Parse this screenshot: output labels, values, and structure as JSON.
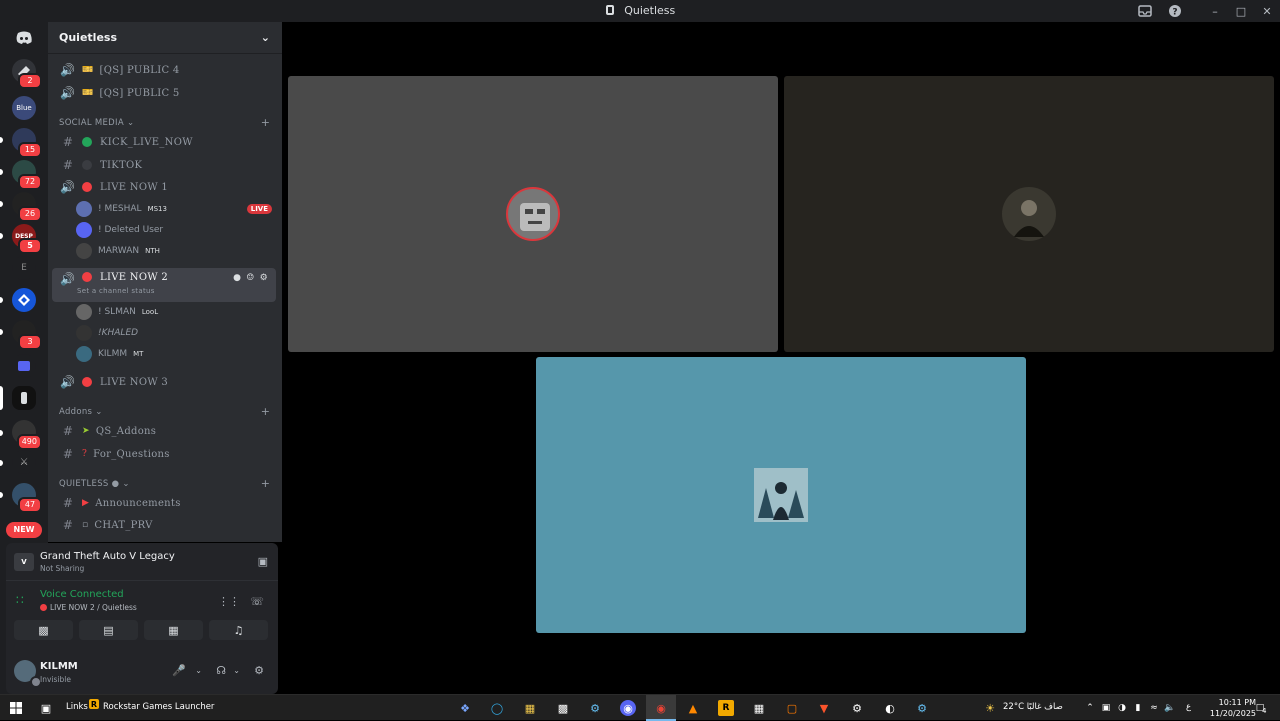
{
  "window": {
    "title": "Quietless"
  },
  "server_sidebar": {
    "badges": [
      "2",
      "15",
      "72",
      "26",
      "5",
      "3",
      "490",
      "47"
    ],
    "new_label": "NEW"
  },
  "guild": {
    "name": "Quietless"
  },
  "channels": {
    "public4": "[QS] PUBLIC 4",
    "public5": "[QS] PUBLIC 5",
    "cat_social": "SOCIAL MEDIA",
    "kick": "KICK_LIVE_NOW",
    "tiktok": "TIKTOK",
    "live1": "LIVE NOW 1",
    "live2": "LIVE NOW 2",
    "live2_status": "Set a channel status",
    "live3": "LIVE NOW 3",
    "cat_addons": "Addons",
    "qs_addons": "QS_Addons",
    "for_questions": "For_Questions",
    "cat_quietless": "QUIETLESS",
    "announcements": "Announcements",
    "chat_prv": "CHAT_PRV",
    "live_badge": "LIVE"
  },
  "voice_users": {
    "live1": [
      {
        "name": "! MESHAL",
        "tag": "MS13"
      },
      {
        "name": "! Deleted User",
        "tag": ""
      },
      {
        "name": "MARWAN",
        "tag": "NTH"
      }
    ],
    "live2": [
      {
        "name": "! SLMAN",
        "tag": "LooL"
      },
      {
        "name": "!KHALED",
        "tag": ""
      },
      {
        "name": "KILMM",
        "tag": "MT"
      }
    ]
  },
  "activity": {
    "game": "Grand Theft Auto V Legacy",
    "sharing": "Not Sharing"
  },
  "voice": {
    "status": "Voice Connected",
    "location": "LIVE NOW 2 / Quietless"
  },
  "me": {
    "name": "KILMM",
    "status": "Invisible"
  },
  "taskbar": {
    "links_label": "Links",
    "rockstar": "Rockstar Games Launcher",
    "weather": "22°C صاف غالبًا",
    "lang": "ع",
    "time": "10:11 PM",
    "date": "11/20/2025",
    "notif_count": "4"
  },
  "colors": {
    "accent": "#5865f2",
    "live_red": "#f23f43",
    "online_green": "#23a55a",
    "tile1": "#4a4a4a",
    "tile2": "#26241f",
    "tile3": "#5697ab"
  }
}
